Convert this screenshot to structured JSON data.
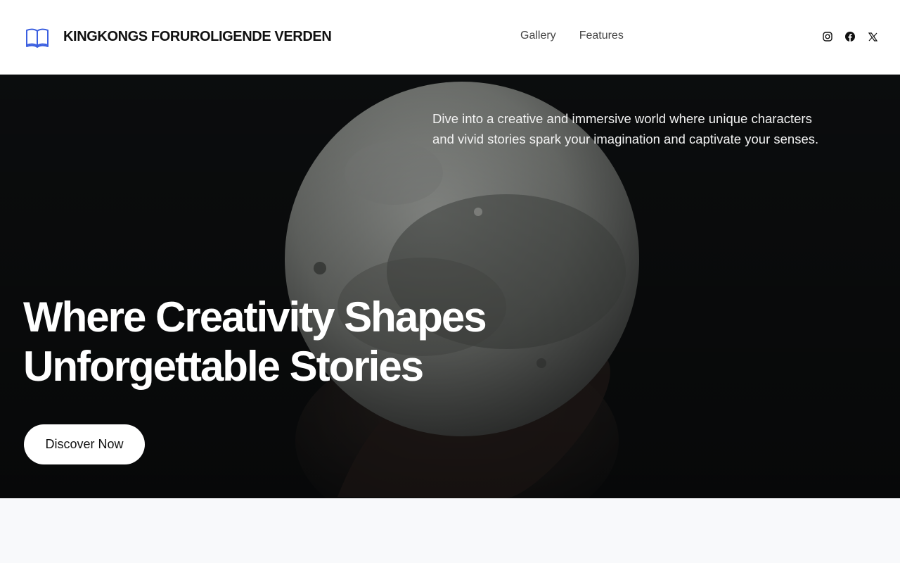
{
  "header": {
    "brand_name": "KINGKONGS FORUROLIGENDE VERDEN",
    "brand_icon": "open-book-icon",
    "nav": [
      {
        "label": "Gallery"
      },
      {
        "label": "Features"
      }
    ],
    "socials": [
      {
        "icon": "instagram-icon"
      },
      {
        "icon": "facebook-icon"
      },
      {
        "icon": "x-icon"
      }
    ]
  },
  "hero": {
    "description": "Dive into a creative and immersive world where unique characters and vivid stories spark your imagination and captivate your senses.",
    "title_line1": "Where Creativity Shapes",
    "title_line2": "Unforgettable Stories",
    "cta_label": "Discover Now"
  },
  "colors": {
    "brand_accent": "#3b5fe0",
    "hero_background": "#0d0f10",
    "page_background": "#f8f9fb"
  }
}
